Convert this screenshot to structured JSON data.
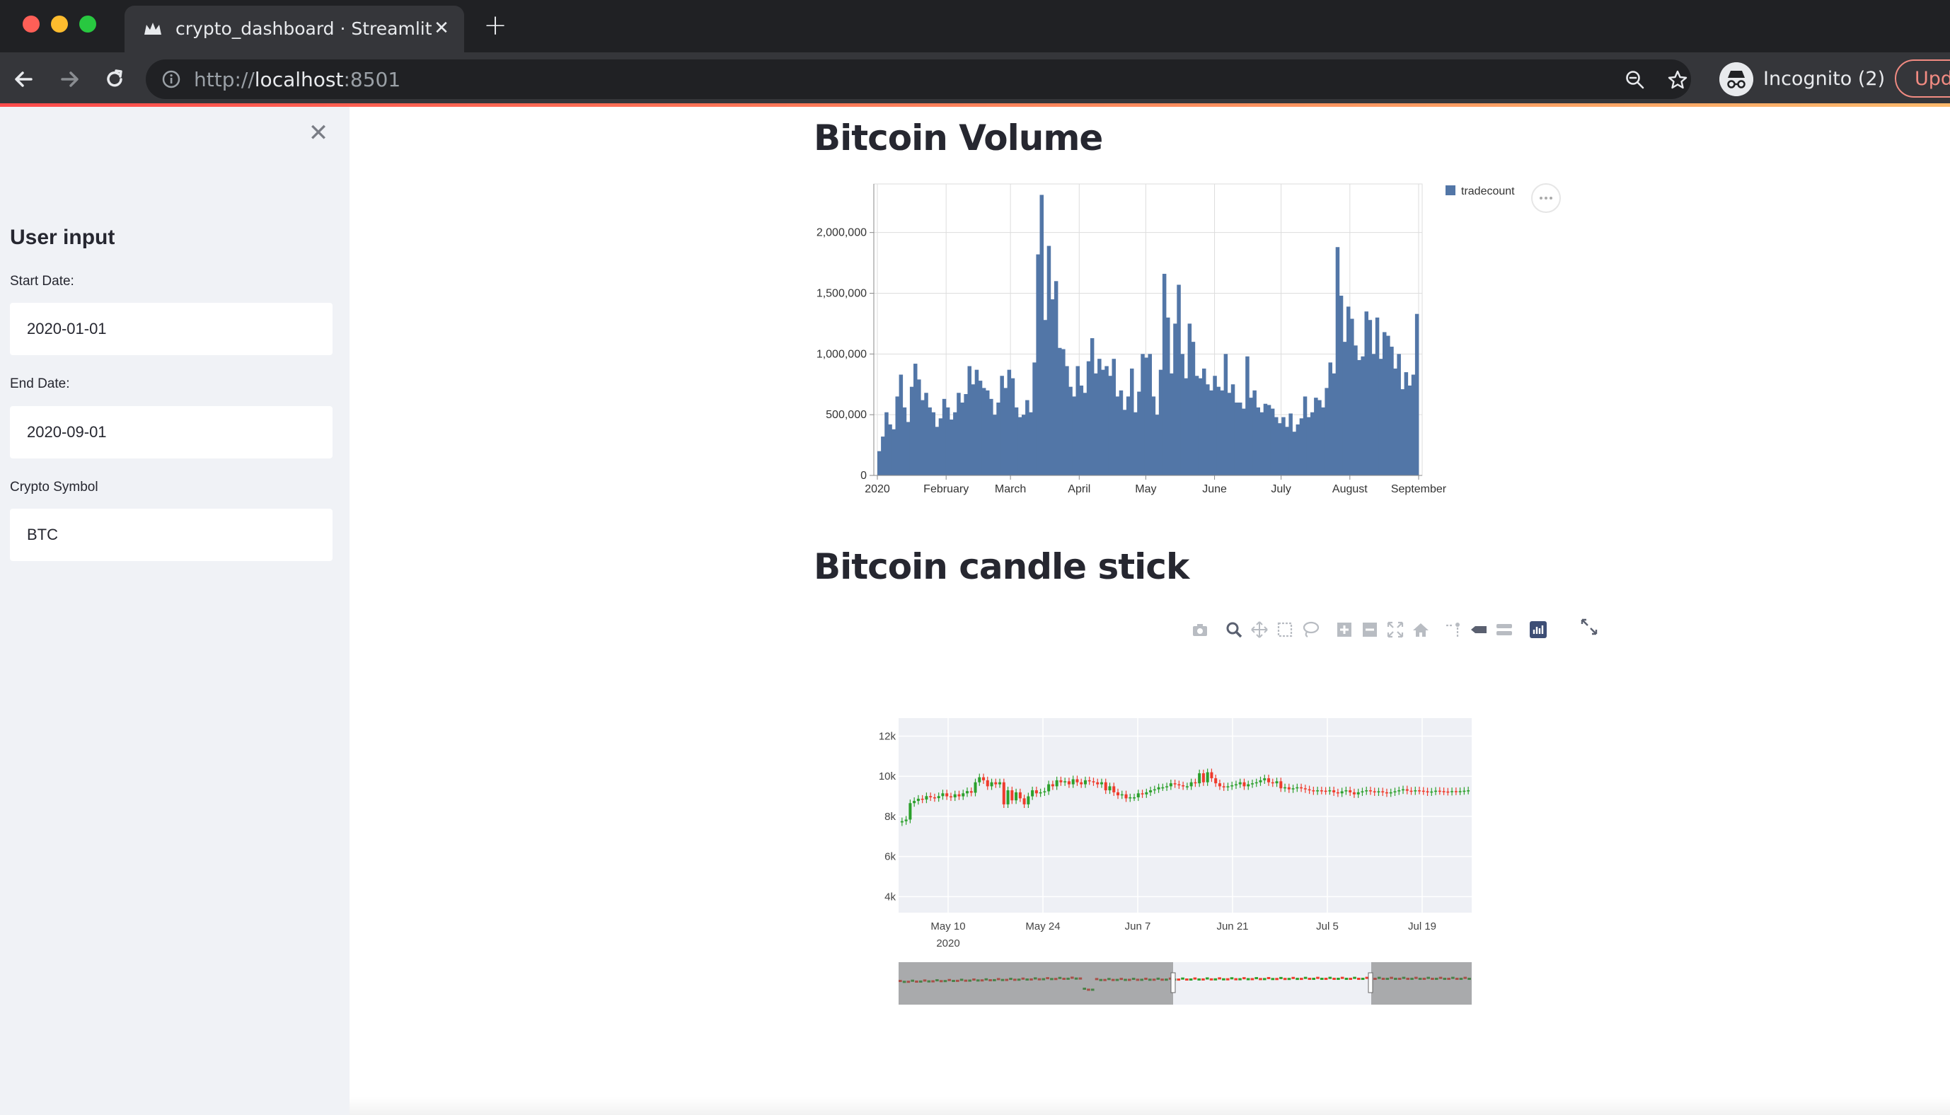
{
  "browser": {
    "tab_title": "crypto_dashboard · Streamlit",
    "url_scheme": "http://",
    "url_host": "localhost",
    "url_port": ":8501",
    "incognito_label": "Incognito (2)",
    "update_label": "Upd"
  },
  "sidebar": {
    "heading": "User input",
    "fields": [
      {
        "label": "Start Date:",
        "value": "2020-01-01"
      },
      {
        "label": "End Date:",
        "value": "2020-09-01"
      },
      {
        "label": "Crypto Symbol",
        "value": "BTC"
      }
    ]
  },
  "main": {
    "volume_title": "Bitcoin Volume",
    "candle_title": "Bitcoin candle stick"
  },
  "icons": {
    "favicon": "streamlit-crown-icon",
    "modebar": [
      "camera-icon",
      "zoom-icon",
      "pan-icon",
      "box-select-icon",
      "lasso-icon",
      "zoom-in-icon",
      "zoom-out-icon",
      "autoscale-icon",
      "reset-axes-icon",
      "spike-lines-icon",
      "hover-closest-icon",
      "hover-compare-icon",
      "plotly-logo-icon"
    ],
    "fullscreen": "fullscreen-icon"
  },
  "colors": {
    "bar": "#5276a7",
    "increasing": "#2ca02c",
    "decreasing": "#ef3b2c",
    "accent": "#ff4b4b"
  },
  "chart_data": [
    {
      "type": "bar",
      "title": "Bitcoin Volume",
      "legend": [
        "tradecount"
      ],
      "legend_placement": "top-right",
      "x_range": [
        "2020-01-01",
        "2020-09-01"
      ],
      "x_ticks": [
        "2020",
        "February",
        "March",
        "April",
        "May",
        "June",
        "July",
        "August",
        "September"
      ],
      "y_ticks": [
        "0",
        "500,000",
        "1,000,000",
        "1,500,000",
        "2,000,000"
      ],
      "ylim": [
        0,
        2400000
      ],
      "grid": true,
      "series": [
        {
          "name": "tradecount",
          "values": [
            200000,
            320000,
            520000,
            420000,
            380000,
            650000,
            830000,
            560000,
            440000,
            730000,
            920000,
            790000,
            620000,
            680000,
            560000,
            520000,
            400000,
            470000,
            630000,
            560000,
            460000,
            520000,
            680000,
            600000,
            670000,
            900000,
            750000,
            870000,
            780000,
            720000,
            700000,
            630000,
            500000,
            600000,
            820000,
            720000,
            870000,
            800000,
            560000,
            480000,
            500000,
            620000,
            520000,
            930000,
            1820000,
            2310000,
            1280000,
            1890000,
            1450000,
            1600000,
            1050000,
            1040000,
            900000,
            730000,
            650000,
            900000,
            740000,
            680000,
            940000,
            1130000,
            840000,
            960000,
            870000,
            900000,
            820000,
            960000,
            650000,
            700000,
            540000,
            650000,
            880000,
            520000,
            690000,
            1000000,
            970000,
            1000000,
            650000,
            500000,
            870000,
            1660000,
            1300000,
            840000,
            1250000,
            1570000,
            1000000,
            800000,
            1250000,
            1100000,
            820000,
            800000,
            880000,
            750000,
            700000,
            820000,
            730000,
            700000,
            1000000,
            680000,
            750000,
            600000,
            600000,
            550000,
            980000,
            640000,
            700000,
            560000,
            520000,
            590000,
            580000,
            550000,
            480000,
            430000,
            480000,
            400000,
            510000,
            360000,
            420000,
            470000,
            650000,
            480000,
            520000,
            640000,
            620000,
            560000,
            720000,
            930000,
            840000,
            1880000,
            1480000,
            1100000,
            1390000,
            1290000,
            1070000,
            950000,
            980000,
            1350000,
            1280000,
            1000000,
            1300000,
            960000,
            1180000,
            1150000,
            1060000,
            880000,
            1000000,
            710000,
            850000,
            740000,
            830000,
            1330000
          ]
        }
      ]
    },
    {
      "type": "candlestick",
      "title": "Bitcoin candle stick",
      "x_ticks": [
        "May 10",
        "May 24",
        "Jun 7",
        "Jun 21",
        "Jul 5",
        "Jul 19"
      ],
      "x_tick_year": "2020",
      "y_ticks": [
        "4k",
        "6k",
        "8k",
        "10k",
        "12k"
      ],
      "ylim": [
        3200,
        12900
      ],
      "visible_range": [
        "2020-04-27",
        "2020-07-26"
      ],
      "range_slider": true,
      "series": [
        {
          "open": [
            7700,
            7760,
            7840,
            8660,
            8770,
            8880,
            8840,
            9010,
            8950,
            8910,
            9010,
            9150,
            9000,
            8950,
            9100,
            9000,
            9150,
            9260,
            9180,
            9700,
            9950,
            9800,
            9500,
            9700,
            9600,
            9700,
            8600,
            9300,
            8800,
            9200,
            8900,
            8600,
            9000,
            9300,
            9150,
            9200,
            9250,
            9600,
            9500,
            9800,
            9700,
            9750,
            9600,
            9850,
            9700,
            9600,
            9800,
            9750,
            9700,
            9600,
            9700,
            9300,
            9500,
            9200,
            9050,
            9100,
            8900,
            8950,
            8950,
            9150,
            9100,
            9200,
            9300,
            9350,
            9450,
            9450,
            9500,
            9650,
            9600,
            9550,
            9500,
            9500,
            9700,
            9650,
            10150,
            9700,
            10200,
            9900,
            9650,
            9500,
            9450,
            9500,
            9550,
            9600,
            9700,
            9500,
            9600,
            9650,
            9700,
            9800,
            9900,
            9700,
            9650,
            9750,
            9400
          ],
          "close": [
            7760,
            7840,
            8660,
            8770,
            8880,
            8840,
            9010,
            8950,
            8910,
            9010,
            9150,
            9000,
            8950,
            9100,
            9000,
            9150,
            9260,
            9180,
            9700,
            9950,
            9800,
            9500,
            9700,
            9600,
            9700,
            8600,
            9300,
            8800,
            9200,
            8900,
            8600,
            9000,
            9300,
            9150,
            9200,
            9250,
            9600,
            9500,
            9800,
            9700,
            9750,
            9600,
            9850,
            9700,
            9600,
            9800,
            9750,
            9700,
            9600,
            9700,
            9300,
            9500,
            9200,
            9050,
            9100,
            8900,
            8950,
            8950,
            9150,
            9100,
            9200,
            9300,
            9350,
            9450,
            9450,
            9500,
            9650,
            9600,
            9550,
            9500,
            9500,
            9700,
            9650,
            10150,
            9700,
            10200,
            9900,
            9650,
            9500,
            9450,
            9500,
            9550,
            9600,
            9700,
            9500,
            9600,
            9650,
            9700,
            9800,
            9900,
            9700,
            9650,
            9750,
            9400,
            9450
          ],
          "tail": [
            9350,
            9400,
            9450,
            9400,
            9350,
            9300,
            9250,
            9300,
            9280,
            9260,
            9300,
            9200,
            9150,
            9250,
            9300,
            9200,
            9100,
            9200,
            9250,
            9300,
            9250,
            9200,
            9250,
            9200,
            9150,
            9200,
            9250,
            9300,
            9350,
            9280,
            9250,
            9300,
            9280,
            9250,
            9200,
            9240,
            9280,
            9260,
            9240,
            9220,
            9260,
            9240,
            9260,
            9280,
            9300
          ]
        }
      ]
    }
  ]
}
